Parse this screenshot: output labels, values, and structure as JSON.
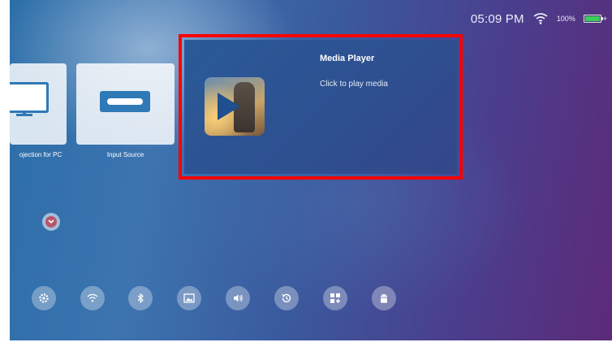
{
  "status_bar": {
    "time": "05:09 PM",
    "battery_percent": "100%",
    "battery_level": 1.0,
    "charging_symbol": "+",
    "wifi_icon": "wifi-icon"
  },
  "tiles": [
    {
      "label": "ojection for PC",
      "icon": "monitor-icon"
    },
    {
      "label": "Input Source",
      "icon": "input-source-icon"
    }
  ],
  "focused_card": {
    "title": "Media Player",
    "subtitle": "Click to play media",
    "icon": "media-player-icon",
    "highlight_color": "#ff0000"
  },
  "store_icon": "store-icon",
  "dock": [
    {
      "name": "settings-icon"
    },
    {
      "name": "wifi-settings-icon"
    },
    {
      "name": "bluetooth-icon"
    },
    {
      "name": "picture-icon"
    },
    {
      "name": "sound-icon"
    },
    {
      "name": "history-icon"
    },
    {
      "name": "apps-add-icon"
    },
    {
      "name": "android-icon"
    }
  ]
}
